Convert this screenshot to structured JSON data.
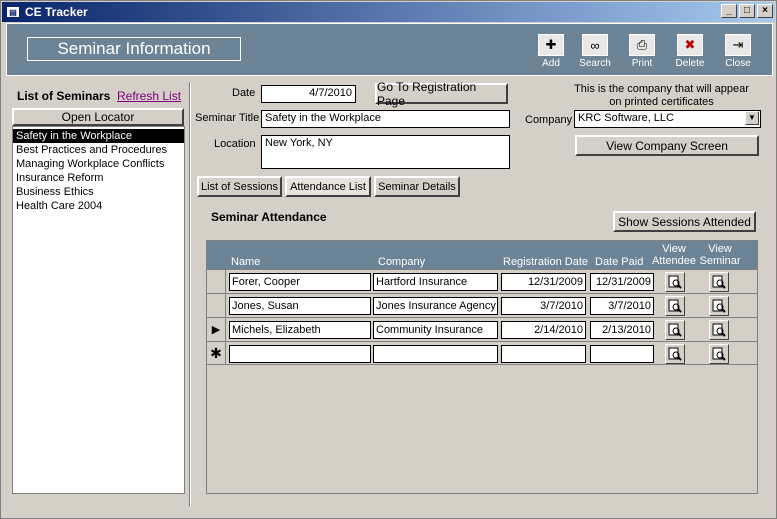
{
  "window": {
    "title": "CE Tracker"
  },
  "header": {
    "title": "Seminar Information"
  },
  "toolbar": [
    {
      "label": "Add",
      "icon": "add-icon"
    },
    {
      "label": "Search",
      "icon": "binoculars-icon"
    },
    {
      "label": "Print",
      "icon": "printer-icon"
    },
    {
      "label": "Delete",
      "icon": "delete-icon"
    },
    {
      "label": "Close",
      "icon": "close-door-icon"
    }
  ],
  "left": {
    "title": "List of Seminars",
    "refresh": "Refresh List",
    "open_locator": "Open Locator",
    "seminars": [
      "Safety in the Workplace",
      "Best Practices and Procedures",
      "Managing Workplace Conflicts",
      "Insurance Reform",
      "Business Ethics",
      "Health Care 2004"
    ]
  },
  "form": {
    "date_label": "Date",
    "date_value": "4/7/2010",
    "goto_reg": "Go To Registration Page",
    "title_label": "Seminar Title",
    "title_value": "Safety in the Workplace",
    "location_label": "Location",
    "location_value": "New York, NY",
    "company_note": "This is the company that will appear on printed certificates",
    "company_label": "Company",
    "company_value": "KRC Software, LLC",
    "view_company": "View Company Screen"
  },
  "tabs": [
    "List of Sessions",
    "Attendance List",
    "Seminar Details"
  ],
  "attendance": {
    "title": "Seminar Attendance",
    "show_sessions": "Show Sessions Attended",
    "headers": {
      "name": "Name",
      "company": "Company",
      "reg_date": "Registration Date",
      "date_paid": "Date Paid",
      "view_attendee": "View Attendee",
      "view_seminar": "View Seminar"
    },
    "rows": [
      {
        "marker": "",
        "name": "Forer, Cooper",
        "company": "Hartford Insurance",
        "reg_date": "12/31/2009",
        "date_paid": "12/31/2009"
      },
      {
        "marker": "",
        "name": "Jones, Susan",
        "company": "Jones Insurance Agency",
        "reg_date": "3/7/2010",
        "date_paid": "3/7/2010"
      },
      {
        "marker": "▶",
        "name": "Michels, Elizabeth",
        "company": "Community Insurance",
        "reg_date": "2/14/2010",
        "date_paid": "2/13/2010"
      },
      {
        "marker": "✱",
        "name": "",
        "company": "",
        "reg_date": "",
        "date_paid": ""
      }
    ]
  }
}
